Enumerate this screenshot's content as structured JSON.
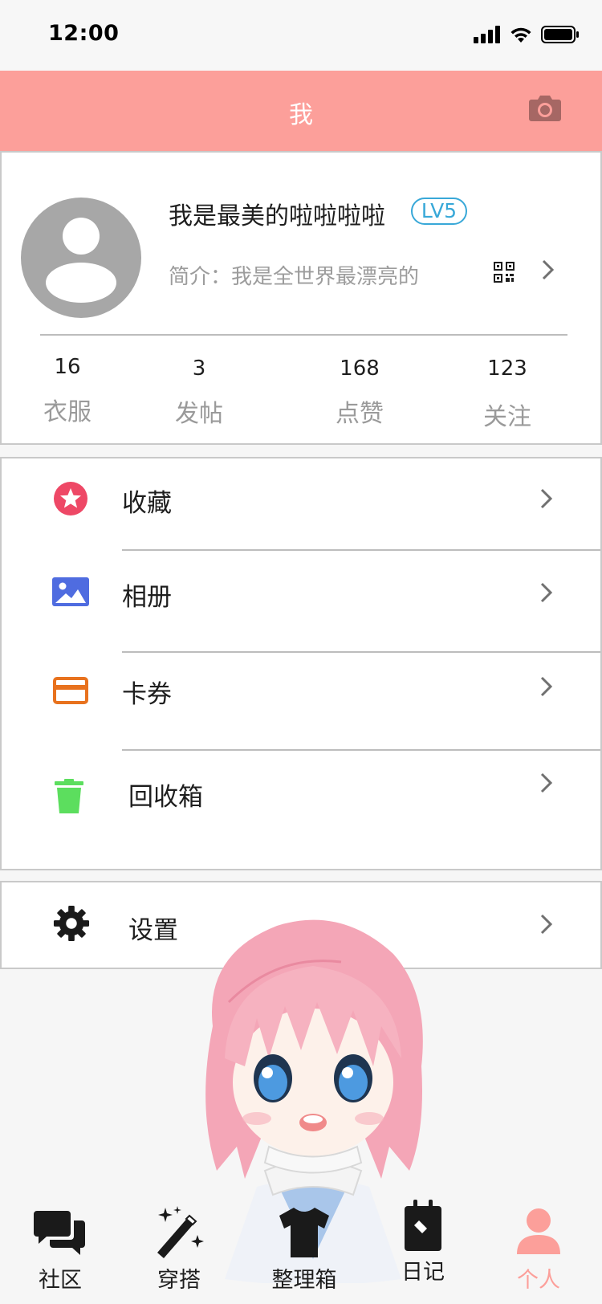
{
  "status_bar": {
    "time": "12:00"
  },
  "header": {
    "title": "我",
    "camera_icon": "camera-icon"
  },
  "profile": {
    "username": "我是最美的啦啦啦啦",
    "level": "LV5",
    "bio": "简介：我是全世界最漂亮的",
    "stats": [
      {
        "value": "16",
        "label": "衣服"
      },
      {
        "value": "3",
        "label": "发帖"
      },
      {
        "value": "168",
        "label": "点赞"
      },
      {
        "value": "123",
        "label": "关注"
      }
    ]
  },
  "menu": [
    {
      "label": "收藏",
      "icon": "star-icon",
      "color": "#ee4866"
    },
    {
      "label": "相册",
      "icon": "photo-album-icon",
      "color": "#4f6ce0"
    },
    {
      "label": "卡券",
      "icon": "card-icon",
      "color": "#e8721e"
    },
    {
      "label": "回收箱",
      "icon": "trash-icon",
      "color": "#5cde5e"
    }
  ],
  "settings": {
    "label": "设置",
    "icon": "gear-icon"
  },
  "tabs": [
    {
      "label": "社区",
      "icon": "chat-bubbles-icon",
      "active": false
    },
    {
      "label": "穿搭",
      "icon": "magic-wand-icon",
      "active": false
    },
    {
      "label": "整理箱",
      "icon": "tshirt-icon",
      "active": false
    },
    {
      "label": "日记",
      "icon": "diary-icon",
      "active": false
    },
    {
      "label": "个人",
      "icon": "person-icon",
      "active": true
    }
  ],
  "colors": {
    "accent": "#fc9f9a",
    "level_badge": "#38a8d8",
    "avatar_bg": "#a7a7a7"
  }
}
